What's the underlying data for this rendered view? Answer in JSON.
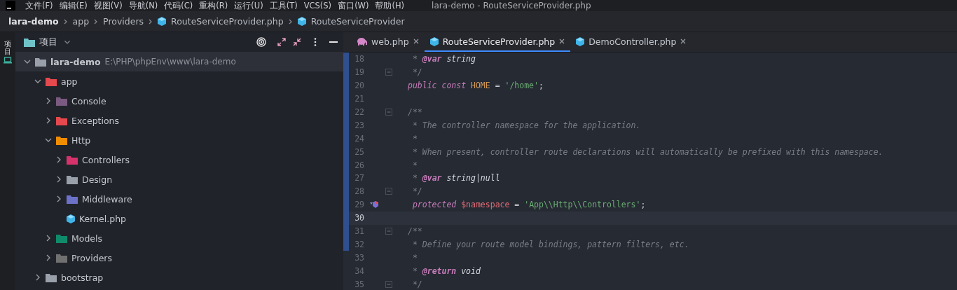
{
  "menu_bar": {
    "items": [
      "文件(F)",
      "编辑(E)",
      "视图(V)",
      "导航(N)",
      "代码(C)",
      "重构(R)",
      "运行(U)",
      "工具(T)",
      "VCS(S)",
      "窗口(W)",
      "帮助(H)"
    ],
    "window_title": "lara-demo - RouteServiceProvider.php"
  },
  "breadcrumbs": [
    {
      "label": "lara-demo",
      "kind": "project"
    },
    {
      "label": "app",
      "kind": "folder"
    },
    {
      "label": "Providers",
      "kind": "folder"
    },
    {
      "label": "RouteServiceProvider.php",
      "kind": "php"
    },
    {
      "label": "RouteServiceProvider",
      "kind": "php"
    }
  ],
  "side_strip": {
    "label": "项目"
  },
  "project_panel": {
    "title": "项目",
    "tree": [
      {
        "label": "lara-demo",
        "path": "E:\\PHP\\phpEnv\\www\\lara-demo",
        "kind": "folder",
        "color": "#9aa0aa",
        "expanded": true,
        "selected": true,
        "children": [
          {
            "label": "app",
            "kind": "folder",
            "color": "#e5484d",
            "expanded": true,
            "selected": false,
            "children": [
              {
                "label": "Console",
                "kind": "folder",
                "color": "#7a5a80",
                "expanded": false,
                "selected": false
              },
              {
                "label": "Exceptions",
                "kind": "folder",
                "color": "#e5484d",
                "expanded": false,
                "selected": false
              },
              {
                "label": "Http",
                "kind": "folder",
                "color": "#f08c00",
                "expanded": true,
                "selected": false,
                "children": [
                  {
                    "label": "Controllers",
                    "kind": "folder",
                    "color": "#d6336c",
                    "expanded": false,
                    "selected": false
                  },
                  {
                    "label": "Design",
                    "kind": "folder",
                    "color": "#9aa0aa",
                    "expanded": false,
                    "selected": false
                  },
                  {
                    "label": "Middleware",
                    "kind": "folder",
                    "color": "#6c72c8",
                    "expanded": false,
                    "selected": false
                  },
                  {
                    "label": "Kernel.php",
                    "kind": "php",
                    "selected": false
                  }
                ]
              },
              {
                "label": "Models",
                "kind": "folder",
                "color": "#0f8a6a",
                "expanded": false,
                "selected": false
              },
              {
                "label": "Providers",
                "kind": "folder",
                "color": "#707070",
                "expanded": false,
                "selected": false
              }
            ]
          },
          {
            "label": "bootstrap",
            "kind": "folder",
            "color": "#9aa0aa",
            "expanded": false,
            "selected": false
          }
        ]
      }
    ]
  },
  "editor": {
    "tabs": [
      {
        "label": "web.php",
        "kind": "elephant",
        "selected": false
      },
      {
        "label": "RouteServiceProvider.php",
        "kind": "php",
        "selected": true
      },
      {
        "label": "DemoController.php",
        "kind": "php",
        "selected": false
      }
    ],
    "lines": [
      {
        "number": "18",
        "changed": true,
        "current": false,
        "fold": false,
        "override": false,
        "tokens": [
          {
            "kind": "comment",
            "text": " * "
          },
          {
            "kind": "doctag",
            "text": "@var"
          },
          {
            "kind": "type",
            "text": " string"
          }
        ]
      },
      {
        "number": "19",
        "changed": true,
        "current": false,
        "fold": true,
        "override": false,
        "tokens": [
          {
            "kind": "comment",
            "text": " */"
          }
        ]
      },
      {
        "number": "20",
        "changed": true,
        "current": false,
        "fold": false,
        "override": false,
        "tokens": [
          {
            "kind": "keyword",
            "text": "public const "
          },
          {
            "kind": "const",
            "text": "HOME"
          },
          {
            "kind": "plain",
            "text": " = "
          },
          {
            "kind": "string",
            "text": "'/home'"
          },
          {
            "kind": "plain",
            "text": ";"
          }
        ]
      },
      {
        "number": "21",
        "changed": true,
        "current": false,
        "fold": false,
        "override": false
      },
      {
        "number": "22",
        "changed": true,
        "current": false,
        "fold": true,
        "override": false,
        "tokens": [
          {
            "kind": "comment",
            "text": "/**"
          }
        ]
      },
      {
        "number": "23",
        "changed": true,
        "current": false,
        "fold": false,
        "override": false,
        "tokens": [
          {
            "kind": "comment",
            "text": " * The controller namespace for the application."
          }
        ]
      },
      {
        "number": "24",
        "changed": true,
        "current": false,
        "fold": false,
        "override": false,
        "tokens": [
          {
            "kind": "comment",
            "text": " *"
          }
        ]
      },
      {
        "number": "25",
        "changed": true,
        "current": false,
        "fold": false,
        "override": false,
        "tokens": [
          {
            "kind": "comment",
            "text": " * When present, controller route declarations will automatically be prefixed with this namespace."
          }
        ]
      },
      {
        "number": "26",
        "changed": true,
        "current": false,
        "fold": false,
        "override": false,
        "tokens": [
          {
            "kind": "comment",
            "text": " *"
          }
        ]
      },
      {
        "number": "27",
        "changed": true,
        "current": false,
        "fold": false,
        "override": false,
        "tokens": [
          {
            "kind": "comment",
            "text": " * "
          },
          {
            "kind": "doctag",
            "text": "@var"
          },
          {
            "kind": "type",
            "text": " string|null"
          }
        ]
      },
      {
        "number": "28",
        "changed": true,
        "current": false,
        "fold": true,
        "override": false,
        "tokens": [
          {
            "kind": "comment",
            "text": " */"
          }
        ]
      },
      {
        "number": "29",
        "changed": true,
        "current": false,
        "fold": false,
        "override": true,
        "tokens": [
          {
            "kind": "keyword",
            "text": " protected "
          },
          {
            "kind": "var",
            "text": "$namespace"
          },
          {
            "kind": "plain",
            "text": " = "
          },
          {
            "kind": "string",
            "text": "'App\\\\Http\\\\Controllers'"
          },
          {
            "kind": "plain",
            "text": ";"
          }
        ]
      },
      {
        "number": "30",
        "changed": true,
        "current": true,
        "fold": false,
        "override": false
      },
      {
        "number": "31",
        "changed": true,
        "current": false,
        "fold": true,
        "override": false,
        "tokens": [
          {
            "kind": "comment",
            "text": "/**"
          }
        ]
      },
      {
        "number": "32",
        "changed": true,
        "current": false,
        "fold": false,
        "override": false,
        "tokens": [
          {
            "kind": "comment",
            "text": " * Define your route model bindings, pattern filters, etc."
          }
        ]
      },
      {
        "number": "33",
        "changed": false,
        "current": false,
        "fold": false,
        "override": false,
        "tokens": [
          {
            "kind": "comment",
            "text": " *"
          }
        ]
      },
      {
        "number": "34",
        "changed": false,
        "current": false,
        "fold": false,
        "override": false,
        "tokens": [
          {
            "kind": "comment",
            "text": " * "
          },
          {
            "kind": "doctag",
            "text": "@return"
          },
          {
            "kind": "type",
            "text": " void"
          }
        ]
      },
      {
        "number": "35",
        "changed": false,
        "current": false,
        "fold": true,
        "override": false,
        "tokens": [
          {
            "kind": "comment",
            "text": " */"
          }
        ]
      }
    ]
  }
}
